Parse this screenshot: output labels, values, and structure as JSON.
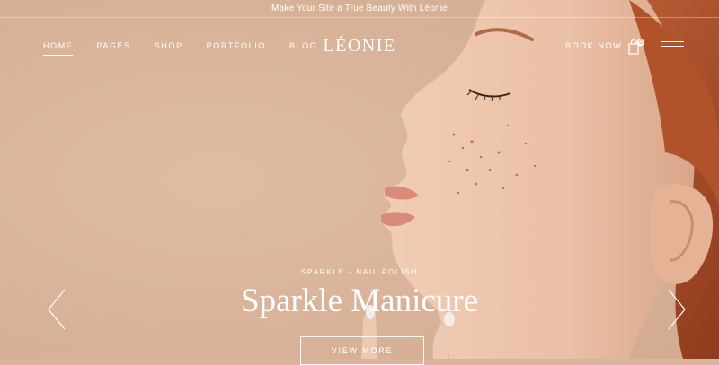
{
  "announcement": "Make Your Site a True Beauty With Léonie",
  "nav": {
    "items": [
      {
        "label": "Home",
        "active": true
      },
      {
        "label": "Pages"
      },
      {
        "label": "Shop"
      },
      {
        "label": "Portfolio"
      },
      {
        "label": "Blog"
      }
    ]
  },
  "logo": "LÉONIE",
  "header": {
    "book_label": "Book Now",
    "cart_icon": "shopping-bag-icon",
    "cart_count": "0",
    "menu_icon": "hamburger-menu-icon"
  },
  "slide": {
    "eyebrow": "Sparkle - Nail Polish",
    "title": "Sparkle Manicure",
    "button_label": "View More",
    "prev_icon": "chevron-left-icon",
    "next_icon": "chevron-right-icon"
  },
  "colors": {
    "background": "#d9b49a",
    "skin": "#eec6ac",
    "hair": "#b7552d",
    "text": "#ffffff"
  }
}
